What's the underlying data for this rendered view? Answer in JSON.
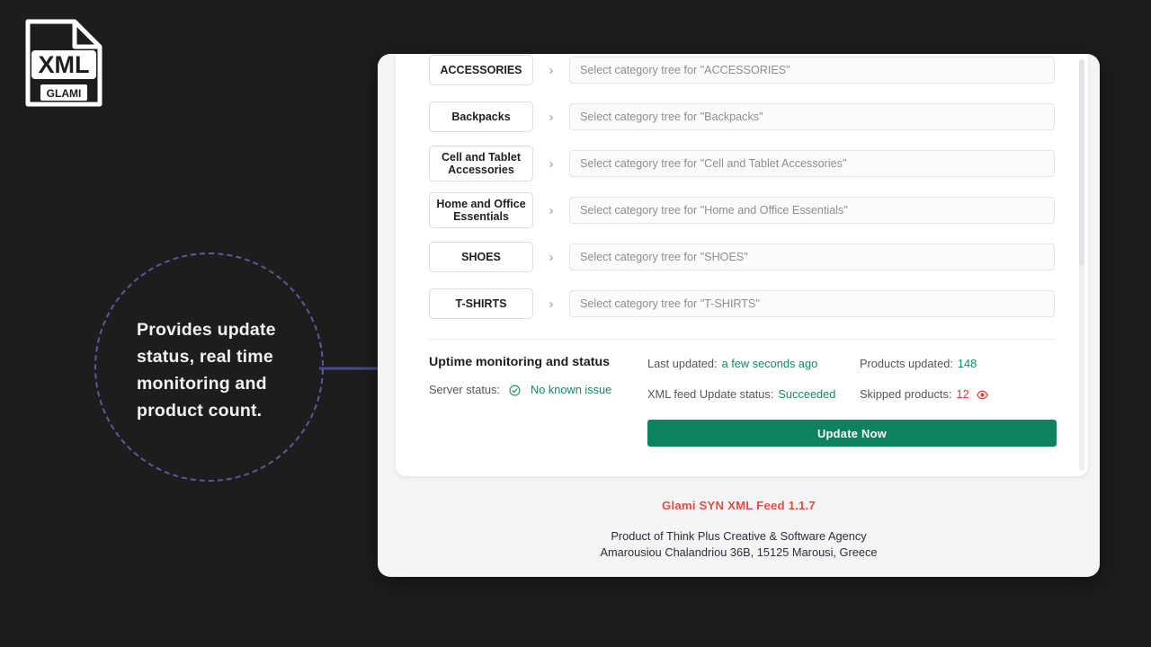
{
  "logo": {
    "title": "XML",
    "subtitle": "GLAMI",
    "alt": "xml-file-icon"
  },
  "annotation": {
    "text": "Provides update status, real time monitoring and product count.",
    "circle_color": "#5c5a9e",
    "arrow_color": "#494a8f"
  },
  "categories": {
    "chevron": "›",
    "rows": [
      {
        "label": "ACCESSORIES",
        "placeholder": "Select category tree for \"ACCESSORIES\""
      },
      {
        "label": "Backpacks",
        "placeholder": "Select category tree for \"Backpacks\""
      },
      {
        "label": "Cell and Tablet Accessories",
        "placeholder": "Select category tree for \"Cell and Tablet Accessories\""
      },
      {
        "label": "Home and Office Essentials",
        "placeholder": "Select category tree for \"Home and Office Essentials\""
      },
      {
        "label": "SHOES",
        "placeholder": "Select category tree for \"SHOES\""
      },
      {
        "label": "T-SHIRTS",
        "placeholder": "Select category tree for \"T-SHIRTS\""
      }
    ]
  },
  "status": {
    "title": "Uptime monitoring and status",
    "server_status_label": "Server status:",
    "server_status_value": "No known issue",
    "server_status_icon": "check-circle-icon",
    "last_updated_label": "Last updated:",
    "last_updated_value": "a few seconds ago",
    "feed_status_label": "XML feed Update status:",
    "feed_status_value": "Succeeded",
    "products_updated_label": "Products updated:",
    "products_updated_value": "148",
    "skipped_label": "Skipped products:",
    "skipped_value": "12",
    "skipped_icon": "eye-icon",
    "update_button": "Update Now",
    "success_color": "#138a63",
    "error_color": "#e23b2e",
    "button_color": "#0d8260"
  },
  "footer": {
    "version": "Glami SYN XML Feed 1.1.7",
    "company": "Product of Think Plus Creative & Software Agency",
    "address": "Amarousiou Chalandriou 36B, 15125 Marousi, Greece",
    "version_color": "#e1503f"
  }
}
